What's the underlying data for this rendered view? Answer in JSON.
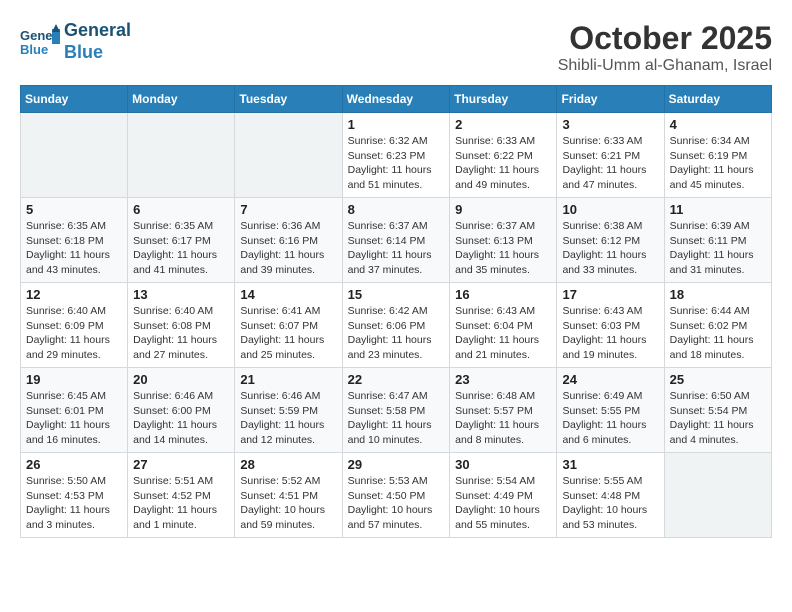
{
  "header": {
    "logo_line1": "General",
    "logo_line2": "Blue",
    "month": "October 2025",
    "location": "Shibli-Umm al-Ghanam, Israel"
  },
  "weekdays": [
    "Sunday",
    "Monday",
    "Tuesday",
    "Wednesday",
    "Thursday",
    "Friday",
    "Saturday"
  ],
  "weeks": [
    [
      {
        "day": "",
        "info": ""
      },
      {
        "day": "",
        "info": ""
      },
      {
        "day": "",
        "info": ""
      },
      {
        "day": "1",
        "info": "Sunrise: 6:32 AM\nSunset: 6:23 PM\nDaylight: 11 hours\nand 51 minutes."
      },
      {
        "day": "2",
        "info": "Sunrise: 6:33 AM\nSunset: 6:22 PM\nDaylight: 11 hours\nand 49 minutes."
      },
      {
        "day": "3",
        "info": "Sunrise: 6:33 AM\nSunset: 6:21 PM\nDaylight: 11 hours\nand 47 minutes."
      },
      {
        "day": "4",
        "info": "Sunrise: 6:34 AM\nSunset: 6:19 PM\nDaylight: 11 hours\nand 45 minutes."
      }
    ],
    [
      {
        "day": "5",
        "info": "Sunrise: 6:35 AM\nSunset: 6:18 PM\nDaylight: 11 hours\nand 43 minutes."
      },
      {
        "day": "6",
        "info": "Sunrise: 6:35 AM\nSunset: 6:17 PM\nDaylight: 11 hours\nand 41 minutes."
      },
      {
        "day": "7",
        "info": "Sunrise: 6:36 AM\nSunset: 6:16 PM\nDaylight: 11 hours\nand 39 minutes."
      },
      {
        "day": "8",
        "info": "Sunrise: 6:37 AM\nSunset: 6:14 PM\nDaylight: 11 hours\nand 37 minutes."
      },
      {
        "day": "9",
        "info": "Sunrise: 6:37 AM\nSunset: 6:13 PM\nDaylight: 11 hours\nand 35 minutes."
      },
      {
        "day": "10",
        "info": "Sunrise: 6:38 AM\nSunset: 6:12 PM\nDaylight: 11 hours\nand 33 minutes."
      },
      {
        "day": "11",
        "info": "Sunrise: 6:39 AM\nSunset: 6:11 PM\nDaylight: 11 hours\nand 31 minutes."
      }
    ],
    [
      {
        "day": "12",
        "info": "Sunrise: 6:40 AM\nSunset: 6:09 PM\nDaylight: 11 hours\nand 29 minutes."
      },
      {
        "day": "13",
        "info": "Sunrise: 6:40 AM\nSunset: 6:08 PM\nDaylight: 11 hours\nand 27 minutes."
      },
      {
        "day": "14",
        "info": "Sunrise: 6:41 AM\nSunset: 6:07 PM\nDaylight: 11 hours\nand 25 minutes."
      },
      {
        "day": "15",
        "info": "Sunrise: 6:42 AM\nSunset: 6:06 PM\nDaylight: 11 hours\nand 23 minutes."
      },
      {
        "day": "16",
        "info": "Sunrise: 6:43 AM\nSunset: 6:04 PM\nDaylight: 11 hours\nand 21 minutes."
      },
      {
        "day": "17",
        "info": "Sunrise: 6:43 AM\nSunset: 6:03 PM\nDaylight: 11 hours\nand 19 minutes."
      },
      {
        "day": "18",
        "info": "Sunrise: 6:44 AM\nSunset: 6:02 PM\nDaylight: 11 hours\nand 18 minutes."
      }
    ],
    [
      {
        "day": "19",
        "info": "Sunrise: 6:45 AM\nSunset: 6:01 PM\nDaylight: 11 hours\nand 16 minutes."
      },
      {
        "day": "20",
        "info": "Sunrise: 6:46 AM\nSunset: 6:00 PM\nDaylight: 11 hours\nand 14 minutes."
      },
      {
        "day": "21",
        "info": "Sunrise: 6:46 AM\nSunset: 5:59 PM\nDaylight: 11 hours\nand 12 minutes."
      },
      {
        "day": "22",
        "info": "Sunrise: 6:47 AM\nSunset: 5:58 PM\nDaylight: 11 hours\nand 10 minutes."
      },
      {
        "day": "23",
        "info": "Sunrise: 6:48 AM\nSunset: 5:57 PM\nDaylight: 11 hours\nand 8 minutes."
      },
      {
        "day": "24",
        "info": "Sunrise: 6:49 AM\nSunset: 5:55 PM\nDaylight: 11 hours\nand 6 minutes."
      },
      {
        "day": "25",
        "info": "Sunrise: 6:50 AM\nSunset: 5:54 PM\nDaylight: 11 hours\nand 4 minutes."
      }
    ],
    [
      {
        "day": "26",
        "info": "Sunrise: 5:50 AM\nSunset: 4:53 PM\nDaylight: 11 hours\nand 3 minutes."
      },
      {
        "day": "27",
        "info": "Sunrise: 5:51 AM\nSunset: 4:52 PM\nDaylight: 11 hours\nand 1 minute."
      },
      {
        "day": "28",
        "info": "Sunrise: 5:52 AM\nSunset: 4:51 PM\nDaylight: 10 hours\nand 59 minutes."
      },
      {
        "day": "29",
        "info": "Sunrise: 5:53 AM\nSunset: 4:50 PM\nDaylight: 10 hours\nand 57 minutes."
      },
      {
        "day": "30",
        "info": "Sunrise: 5:54 AM\nSunset: 4:49 PM\nDaylight: 10 hours\nand 55 minutes."
      },
      {
        "day": "31",
        "info": "Sunrise: 5:55 AM\nSunset: 4:48 PM\nDaylight: 10 hours\nand 53 minutes."
      },
      {
        "day": "",
        "info": ""
      }
    ]
  ]
}
